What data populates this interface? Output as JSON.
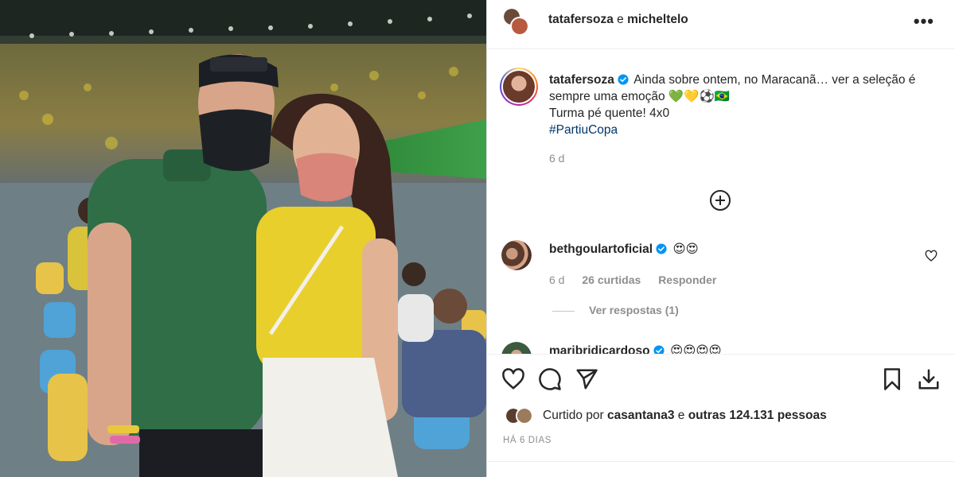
{
  "colors": {
    "accent": "#0095f6",
    "verified": "#0095f6",
    "text": "#262626",
    "muted": "#8e8e8e",
    "hashtag": "#00376b"
  },
  "header": {
    "user1": "tatafersoza",
    "conjunction": "e",
    "user2": "micheltelo",
    "more_icon": "more-options-icon"
  },
  "caption": {
    "username": "tatafersoza",
    "line1": "Ainda sobre ontem, no Maracanã… ver a seleção é sempre uma emoção 💚💛⚽🇧🇷",
    "line2": "Turma pé quente! 4x0",
    "hashtag": "#PartiuCopa",
    "age": "6 d"
  },
  "comments": [
    {
      "username": "bethgoulartoficial",
      "text": "😍😍",
      "age": "6 d",
      "likes": "26 curtidas",
      "reply_label": "Responder",
      "replies_label": "Ver respostas (1)"
    },
    {
      "username": "maribridicardoso",
      "text": "😍😍😍😍"
    }
  ],
  "actions": {
    "liked_by_prefix": "Curtido por",
    "liked_by_user": "casantana3",
    "liked_by_and": "e",
    "liked_by_others": "outras 124.131 pessoas",
    "time_ago": "HÁ 6 DIAS"
  }
}
